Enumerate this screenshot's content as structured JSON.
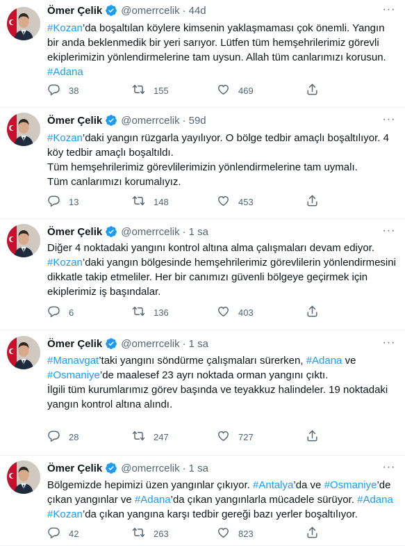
{
  "tweets": [
    {
      "name": "Ömer Çelik",
      "handle": "@omerrcelik",
      "time": "44d",
      "body": [
        [
          {
            "t": "#Kozan",
            "h": 1
          },
          {
            "t": "’da boşaltılan köylere kimsenin yaklaşmaması çok önemli. Yangın bir anda beklenmedik bir yeri sarıyor. Lütfen tüm hemşehrilerimiz görevli ekiplerimizin yönlendirmelerine tam uysun. Allah tüm canlarımızı korusun. "
          },
          {
            "t": "#Adana",
            "h": 1
          }
        ]
      ],
      "replies": "38",
      "retweets": "155",
      "likes": "469"
    },
    {
      "name": "Ömer Çelik",
      "handle": "@omerrcelik",
      "time": "59d",
      "body": [
        [
          {
            "t": "#Kozan",
            "h": 1
          },
          {
            "t": "’daki yangın rüzgarla yayılıyor. O bölge tedbir amaçlı boşaltılıyor. 4 köy tedbir amaçlı boşaltıldı."
          }
        ],
        [
          {
            "t": "Tüm hemşehrilerimiz görevlilerimizin yönlendirmelerine tam uymalı."
          }
        ],
        [
          {
            "t": "Tüm canlarımızı korumalıyız."
          }
        ]
      ],
      "replies": "13",
      "retweets": "148",
      "likes": "453"
    },
    {
      "name": "Ömer Çelik",
      "handle": "@omerrcelik",
      "time": "1 sa",
      "body": [
        [
          {
            "t": "Diğer 4 noktadaki yangını kontrol altına alma çalışmaları devam ediyor. "
          },
          {
            "t": "#Kozan",
            "h": 1
          },
          {
            "t": "’daki yangın bölgesinde hemşehrilerimiz görevlilerin yönlendirmesini dikkatle takip etmeliler. Her bir canımızı güvenli bölgeye geçirmek için ekiplerimiz iş başındalar."
          }
        ]
      ],
      "replies": "6",
      "retweets": "136",
      "likes": "403"
    },
    {
      "name": "Ömer Çelik",
      "handle": "@omerrcelik",
      "time": "1 sa",
      "body": [
        [
          {
            "t": "#Manavgat",
            "h": 1
          },
          {
            "t": "’taki yangını söndürme çalışmaları sürerken, "
          },
          {
            "t": "#Adana",
            "h": 1
          },
          {
            "t": " ve "
          },
          {
            "t": "#Osmaniye",
            "h": 1
          },
          {
            "t": "’de maalesef 23 ayrı noktada orman yangını çıktı."
          }
        ],
        [
          {
            "t": " "
          }
        ],
        [
          {
            "t": "İlgili tüm kurumlarımız görev başında ve teyakkuz halindeler. 19 noktadaki yangın kontrol altına alındı."
          }
        ]
      ],
      "replies": "28",
      "retweets": "247",
      "likes": "727"
    },
    {
      "name": "Ömer Çelik",
      "handle": "@omerrcelik",
      "time": "1 sa",
      "body": [
        [
          {
            "t": "Bölgemizde hepimizi üzen yangınlar çıkıyor. "
          },
          {
            "t": "#Antalya",
            "h": 1
          },
          {
            "t": "’da ve "
          },
          {
            "t": "#Osmaniye",
            "h": 1
          },
          {
            "t": "’de çıkan yangınlar ve "
          },
          {
            "t": "#Adana",
            "h": 1
          },
          {
            "t": "’da çıkan yangınlarla mücadele sürüyor. "
          },
          {
            "t": "#Adana",
            "h": 1
          },
          {
            "t": " "
          },
          {
            "t": "#Kozan",
            "h": 1
          },
          {
            "t": "’da çıkan yangına karşı tedbir gereği bazı yerler boşaltılıyor."
          }
        ]
      ],
      "replies": "42",
      "retweets": "263",
      "likes": "823"
    }
  ],
  "icons": {
    "verified": "verified-badge-icon",
    "more": "more-options-icon",
    "reply": "reply-icon",
    "retweet": "retweet-icon",
    "like": "like-icon",
    "share": "share-icon"
  },
  "colors": {
    "hashtag": "#1d9bf0",
    "secondary_text": "#536471",
    "verified": "#1d9bf0"
  }
}
